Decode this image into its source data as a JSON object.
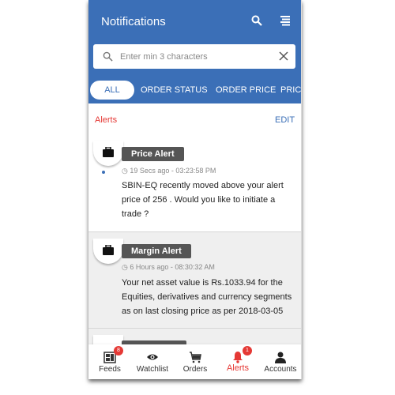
{
  "header": {
    "title": "Notifications",
    "search_placeholder": "Enter min 3 characters",
    "search_value": ""
  },
  "tabs": [
    {
      "label": "ALL",
      "active": true
    },
    {
      "label": "ORDER STATUS"
    },
    {
      "label": "ORDER PRICE"
    },
    {
      "label": "PRIC"
    }
  ],
  "section": {
    "title": "Alerts",
    "edit_label": "EDIT"
  },
  "notifications": [
    {
      "type": "Price Alert",
      "time": "19 Secs ago - 03:23:58 PM",
      "message": "SBIN-EQ recently moved above your alert price of 256 . Would you like to initiate a trade ?",
      "unread": true
    },
    {
      "type": "Margin Alert",
      "time": "6 Hours ago - 08:30:32 AM",
      "message": "Your net asset value is Rs.1033.94 for the Equities, derivatives and currency segments as on last closing price as per 2018-03-05",
      "unread": false
    }
  ],
  "nav": [
    {
      "label": "Feeds",
      "icon": "feeds-icon",
      "badge": "8"
    },
    {
      "label": "Watchlist",
      "icon": "eye-icon"
    },
    {
      "label": "Orders",
      "icon": "cart-icon"
    },
    {
      "label": "Alerts",
      "icon": "bell-icon",
      "badge": "1",
      "active": true
    },
    {
      "label": "Accounts",
      "icon": "person-icon"
    }
  ],
  "colors": {
    "primary": "#3b6fb7",
    "accent": "#e53935",
    "badge_bg": "#555555"
  }
}
